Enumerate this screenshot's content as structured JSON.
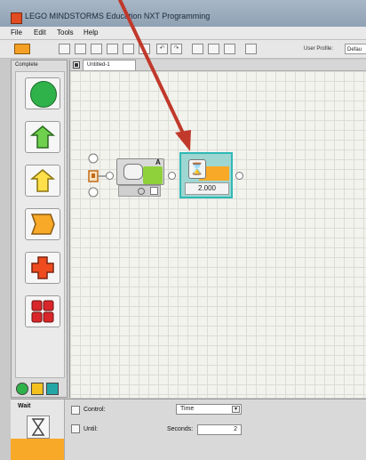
{
  "window": {
    "title": "LEGO MINDSTORMS Education NXT Programming"
  },
  "menu": {
    "items": [
      "File",
      "Edit",
      "Tools",
      "Help"
    ]
  },
  "toolbar": {
    "user_profile_label": "User Profile:",
    "user_profile_value": "Defau"
  },
  "palette": {
    "header": "Complete"
  },
  "document": {
    "tab_name": "Untitled-1"
  },
  "blocks": {
    "move": {
      "port_label": "A"
    },
    "wait": {
      "value": "2.000"
    }
  },
  "config": {
    "title": "Wait",
    "control_label": "Control:",
    "control_value": "Time",
    "until_label": "Until:",
    "seconds_label": "Seconds:",
    "seconds_value": "2"
  },
  "colors": {
    "arrow": "#c0392b",
    "accent_orange": "#f8a928",
    "palette_green": "#2fb24a",
    "wait_border": "#2fb9b6"
  }
}
